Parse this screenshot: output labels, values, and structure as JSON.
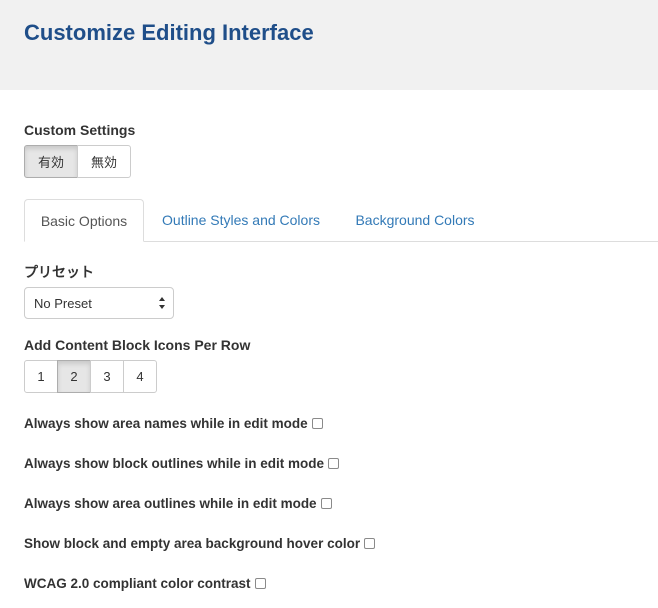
{
  "header": {
    "title": "Customize Editing Interface"
  },
  "custom_settings": {
    "label": "Custom Settings",
    "options": [
      {
        "label": "有効",
        "active": true
      },
      {
        "label": "無効",
        "active": false
      }
    ]
  },
  "tabs": [
    {
      "label": "Basic Options",
      "active": true
    },
    {
      "label": "Outline Styles and Colors",
      "active": false
    },
    {
      "label": "Background Colors",
      "active": false
    }
  ],
  "preset": {
    "label": "プリセット",
    "value": "No Preset"
  },
  "icons_per_row": {
    "label": "Add Content Block Icons Per Row",
    "options": [
      "1",
      "2",
      "3",
      "4"
    ],
    "selected": "2"
  },
  "checkboxes": [
    {
      "label": "Always show area names while in edit mode",
      "checked": false
    },
    {
      "label": "Always show block outlines while in edit mode",
      "checked": false
    },
    {
      "label": "Always show area outlines while in edit mode",
      "checked": false
    },
    {
      "label": "Show block and empty area background hover color",
      "checked": false
    },
    {
      "label": "WCAG 2.0 compliant color contrast",
      "checked": false
    }
  ],
  "colors": {
    "title": "#1f4e89",
    "link": "#337ab7",
    "header_bg": "#f1f1f1"
  }
}
